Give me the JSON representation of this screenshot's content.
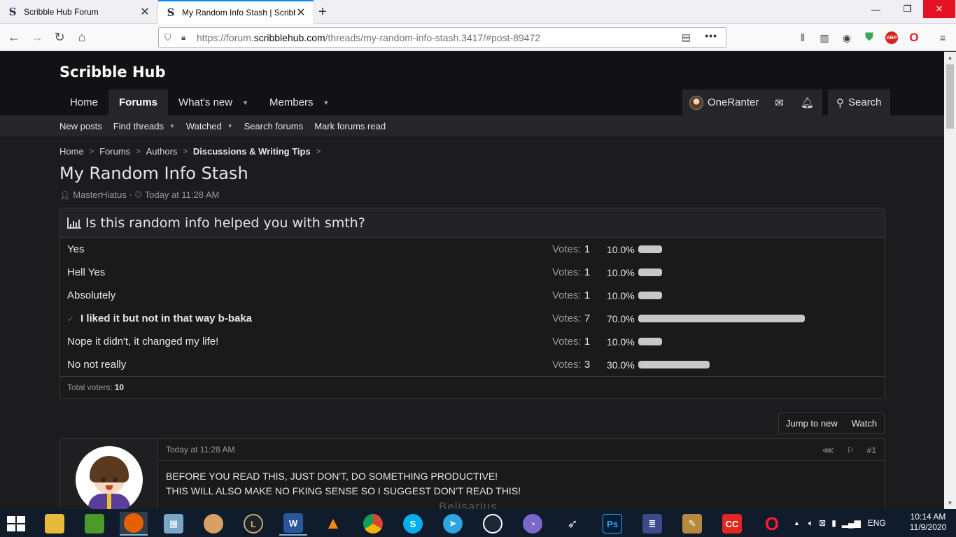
{
  "browser": {
    "tabs": [
      {
        "title": "Scribble Hub Forum",
        "active": false
      },
      {
        "title": "My Random Info Stash | Scribbl",
        "active": true
      }
    ],
    "url_prefix": "https://forum.",
    "url_domain": "scribblehub.com",
    "url_path": "/threads/my-random-info-stash.3417/#post-89472"
  },
  "site": {
    "logo": "Scribble Hub",
    "nav": [
      "Home",
      "Forums",
      "What's new",
      "Members"
    ],
    "active_nav": "Forums",
    "user": "OneRanter",
    "search_label": "Search",
    "subnav": [
      "New posts",
      "Find threads",
      "Watched",
      "Search forums",
      "Mark forums read"
    ]
  },
  "breadcrumbs": [
    "Home",
    "Forums",
    "Authors",
    "Discussions & Writing Tips"
  ],
  "thread": {
    "title": "My Random Info Stash",
    "author": "MasterHiatus",
    "date": "Today at 11:28 AM"
  },
  "poll": {
    "question": "Is this random info helped you with smth?",
    "votes_label": "Votes:",
    "total_label": "Total voters:",
    "total": "10",
    "options": [
      {
        "text": "Yes",
        "votes": "1",
        "percent": "10.0%",
        "fraction": 0.1,
        "mine": false
      },
      {
        "text": "Hell Yes",
        "votes": "1",
        "percent": "10.0%",
        "fraction": 0.1,
        "mine": false
      },
      {
        "text": "Absolutely",
        "votes": "1",
        "percent": "10.0%",
        "fraction": 0.1,
        "mine": false
      },
      {
        "text": "I liked it but not in that way b-baka",
        "votes": "7",
        "percent": "70.0%",
        "fraction": 0.7,
        "mine": true
      },
      {
        "text": "Nope it didn't, it changed my life!",
        "votes": "1",
        "percent": "10.0%",
        "fraction": 0.1,
        "mine": false
      },
      {
        "text": "No not really",
        "votes": "3",
        "percent": "30.0%",
        "fraction": 0.3,
        "mine": false
      }
    ]
  },
  "thread_actions": [
    "Jump to new",
    "Watch"
  ],
  "post": {
    "date": "Today at 11:28 AM",
    "number": "#1",
    "lines": [
      "BEFORE YOU READ THIS, JUST DON'T, DO SOMETHING PRODUCTIVE!",
      "THIS WILL ALSO MAKE NO FKING SENSE SO I SUGGEST DON'T READ THIS!"
    ],
    "avatar_caption": "Belisarius"
  },
  "taskbar": {
    "language": "ENG",
    "time": "10:14 AM",
    "date": "11/9/2020"
  },
  "colors": {
    "bg": "#1c1c1e",
    "header": "#121214",
    "nav_active": "#262628",
    "poll_bar": "#c8c8c8",
    "accent_tab": "#0a84ff"
  }
}
